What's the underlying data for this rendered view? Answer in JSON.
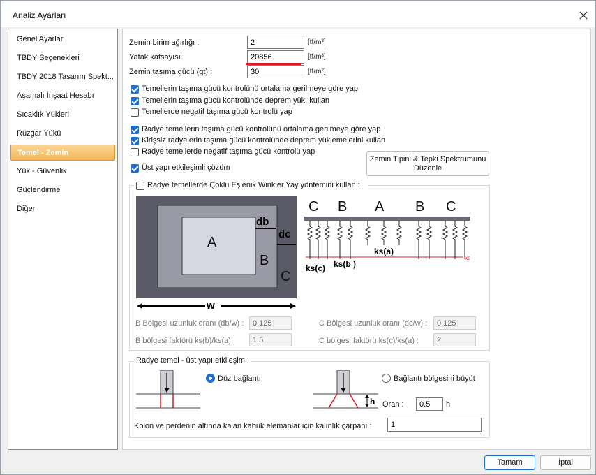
{
  "window": {
    "title": "Analiz Ayarları"
  },
  "sidebar": {
    "items": [
      {
        "label": "Genel Ayarlar"
      },
      {
        "label": "TBDY Seçenekleri"
      },
      {
        "label": "TBDY 2018 Tasarım Spekt..."
      },
      {
        "label": "Aşamalı İnşaat Hesabı"
      },
      {
        "label": "Sıcaklık Yükleri"
      },
      {
        "label": "Rüzgar Yükü"
      },
      {
        "label": "Temel - Zemin"
      },
      {
        "label": "Yük - Güvenlik"
      },
      {
        "label": "Güçlendirme"
      },
      {
        "label": "Diğer"
      }
    ],
    "active": "Temel - Zemin"
  },
  "fields": {
    "zemin_birim": {
      "label": "Zemin birim ağırlığı :",
      "value": "2",
      "unit": "[tf/m³]"
    },
    "yatak": {
      "label": "Yatak katsayısı :",
      "value": "20856",
      "unit": "[tf/m³]"
    },
    "zemin_tasima": {
      "label": "Zemin taşıma gücü (qt) :",
      "value": "30",
      "unit": "[tf/m²]"
    }
  },
  "checks": [
    {
      "label": "Temellerin taşıma gücü kontrolünü ortalama gerilmeye göre yap",
      "checked": true
    },
    {
      "label": "Temellerin taşıma gücü kontrolünde deprem yük. kullan",
      "checked": true
    },
    {
      "label": "Temellerde negatif taşıma gücü kontrolü yap",
      "checked": false
    },
    {
      "label": "Radye temellerin taşıma gücü kontrolünü ortalama gerilmeye göre yap",
      "checked": true
    },
    {
      "label": "Kirişsiz radyelerin taşıma gücü kontrolünde deprem yüklemelerini kullan",
      "checked": true
    },
    {
      "label": "Radye temellerde negatif taşıma gücü kontrolü yap",
      "checked": false
    },
    {
      "label": "Üst yapı etkileşimli çözüm",
      "checked": true
    }
  ],
  "spectrum_button": {
    "line1": "Zemin Tipini  & Tepki Spektrumunu",
    "line2": "Düzenle"
  },
  "winkler": {
    "label": "Radye temellerde Çoklu Eşlenik Winkler Yay yöntemini kullan :",
    "checked": false,
    "diagram_left": {
      "a": "A",
      "b": "B",
      "c": "C",
      "db": "db",
      "dc": "dc",
      "w": "w"
    },
    "diagram_right": {
      "zones": [
        "C",
        "B",
        "A",
        "B",
        "C"
      ],
      "ks_c": "ks(c)",
      "ks_b": "ks(b )",
      "ks_a": "ks(a)",
      "ko": "ko"
    },
    "params": {
      "b_uzunluk": {
        "label": "B Bölgesi uzunluk oranı (db/w) :",
        "value": "0.125"
      },
      "c_uzunluk": {
        "label": "C Bölgesi uzunluk oranı (dc/w) :",
        "value": "0.125"
      },
      "b_faktor": {
        "label": "B bölgesi faktörü ks(b)/ks(a) :",
        "value": "1.5"
      },
      "c_faktor": {
        "label": "C bölgesi faktörü ks(c)/ks(a) :",
        "value": "2"
      }
    }
  },
  "radye_etkilesim": {
    "title": "Radye temel - üst yapı etkileşim :",
    "duz_baglanti": {
      "label": "Düz bağlantı",
      "selected": true
    },
    "baglanti_buyut": {
      "label": "Bağlantı bölgesini büyüt",
      "selected": false
    },
    "h_label": "h",
    "oran": {
      "label": "Oran :",
      "value": "0.5",
      "unit": "h"
    },
    "kalinlik": {
      "label": "Kolon ve perdenin altında kalan kabuk elemanlar için kalınlık çarpanı :",
      "value": "1"
    }
  },
  "footer": {
    "ok": "Tamam",
    "cancel": "İptal"
  },
  "colors": {
    "accent": "#1f6fd1",
    "active_nav": "#f5b65a",
    "red": "#e0192b"
  }
}
